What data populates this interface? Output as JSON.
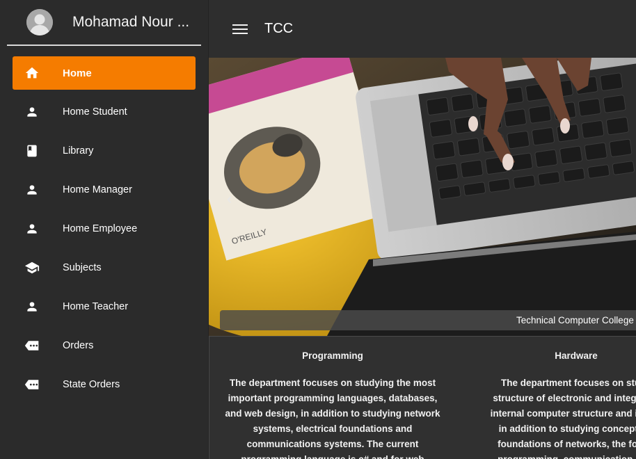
{
  "sidebar": {
    "user_name": "Mohamad Nour ...",
    "avatar_icon": "person-avatar-icon",
    "items": [
      {
        "label": "Home",
        "icon": "home-icon",
        "active": true
      },
      {
        "label": "Home Student",
        "icon": "person-icon",
        "active": false
      },
      {
        "label": "Library",
        "icon": "book-icon",
        "active": false
      },
      {
        "label": "Home Manager",
        "icon": "person-icon",
        "active": false
      },
      {
        "label": "Home Employee",
        "icon": "person-icon",
        "active": false
      },
      {
        "label": "Subjects",
        "icon": "school-icon",
        "active": false
      },
      {
        "label": "Home Teacher",
        "icon": "person-icon",
        "active": false
      },
      {
        "label": "Orders",
        "icon": "tag-icon",
        "active": false
      },
      {
        "label": "State Orders",
        "icon": "tag-icon",
        "active": false
      }
    ]
  },
  "header": {
    "title": "TCC",
    "menu_icon": "hamburger-menu-icon"
  },
  "hero": {
    "caption": "Technical Computer College",
    "prev_icon": "chevron-left-icon"
  },
  "cards": [
    {
      "title": "Programming",
      "body_lines": [
        "The department focuses on studying the most",
        "important programming languages, databases,",
        "and web design, in addition to studying network",
        "systems, electrical foundations and",
        "communications systems. The current",
        "programming language is c# and for web"
      ]
    },
    {
      "title": "Hardware",
      "body_lines": [
        "The department focuses on study",
        "structure of electronic and integrated",
        "internal computer structure and its ma",
        "in addition to studying concepts al",
        "foundations of networks, the found",
        "programming, communication, and"
      ]
    }
  ],
  "colors": {
    "accent": "#f57c00",
    "sidebar_bg": "#2b2b2b",
    "topbar_bg": "#2e2e2e"
  }
}
